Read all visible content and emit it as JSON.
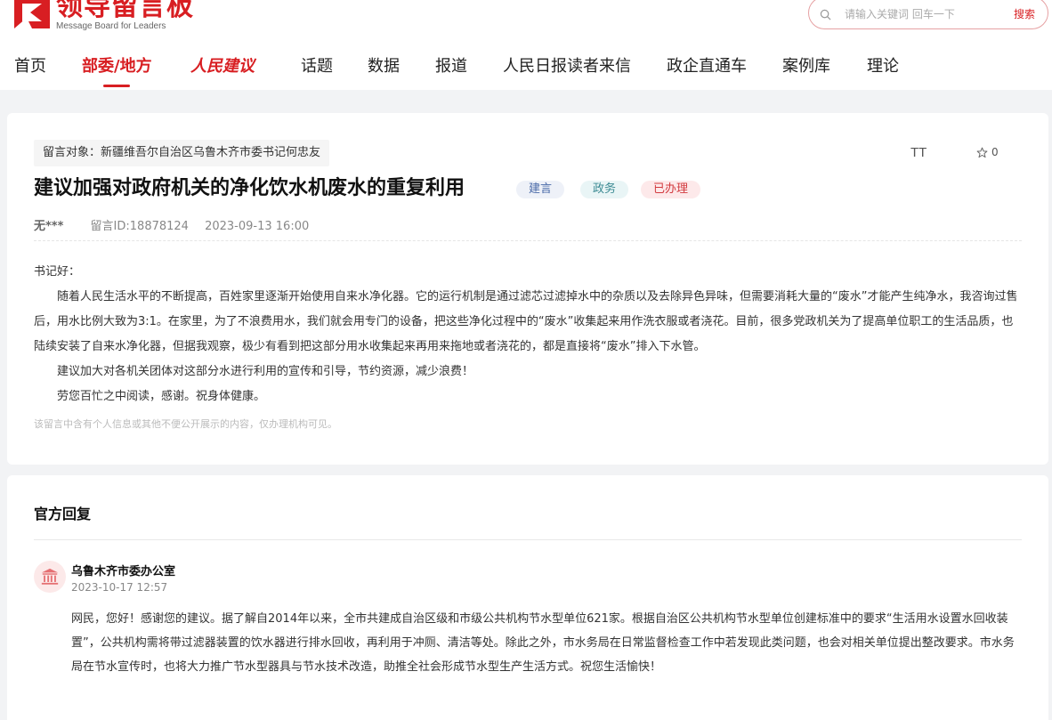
{
  "header": {
    "logo_cn": "领导留言板",
    "logo_en": "Message Board for Leaders",
    "search_placeholder": "请输入关键词 回车一下",
    "search_button": "搜索"
  },
  "nav": {
    "items": [
      "首页",
      "部委/地方",
      "人民建议",
      "话题",
      "数据",
      "报道",
      "人民日报读者来信",
      "政企直通车",
      "案例库",
      "理论"
    ]
  },
  "message": {
    "target": "留言对象：新疆维吾尔自治区乌鲁木齐市委书记何忠友",
    "font_icon_label": "TT",
    "star_count": "0",
    "title": "建议加强对政府机关的净化饮水机废水的重复利用",
    "tags": [
      "建言",
      "政务",
      "已办理"
    ],
    "author": "无***",
    "id": "留言ID:18878124",
    "time": "2023-09-13 16:00",
    "paragraphs": [
      "书记好：",
      "随着人民生活水平的不断提高，百姓家里逐渐开始使用自来水净化器。它的运行机制是通过滤芯过滤掉水中的杂质以及去除异色异味，但需要消耗大量的“废水”才能产生纯净水，我咨询过售后，用水比例大致为3:1。在家里，为了不浪费用水，我们就会用专门的设备，把这些净化过程中的“废水”收集起来用作洗衣服或者浇花。目前，很多党政机关为了提高单位职工的生活品质，也陆续安装了自来水净化器，但据我观察，极少有看到把这部分用水收集起来再用来拖地或者浇花的，都是直接将“废水”排入下水管。",
      "建议加大对各机关团体对这部分水进行利用的宣传和引导，节约资源，减少浪费！",
      "劳您百忙之中阅读，感谢。祝身体健康。"
    ],
    "privacy_note": "该留言中含有个人信息或其他不便公开展示的内容，仅办理机构可见。"
  },
  "reply": {
    "heading": "官方回复",
    "org": "乌鲁木齐市委办公室",
    "time": "2023-10-17 12:57",
    "content": "网民，您好！感谢您的建议。据了解自2014年以来，全市共建成自治区级和市级公共机构节水型单位621家。根据自治区公共机构节水型单位创建标准中的要求“生活用水设置水回收装置”，公共机构需将带过滤器装置的饮水器进行排水回收，再利用于冲厕、清洁等处。除此之外，市水务局在日常监督检查工作中若发现此类问题，也会对相关单位提出整改要求。市水务局在节水宣传时，也将大力推广节水型器具与节水技术改造，助推全社会形成节水型生产生活方式。祝您生活愉快！"
  },
  "colors": {
    "brand": "#d81e22",
    "page_bg": "#f2f3f5"
  }
}
